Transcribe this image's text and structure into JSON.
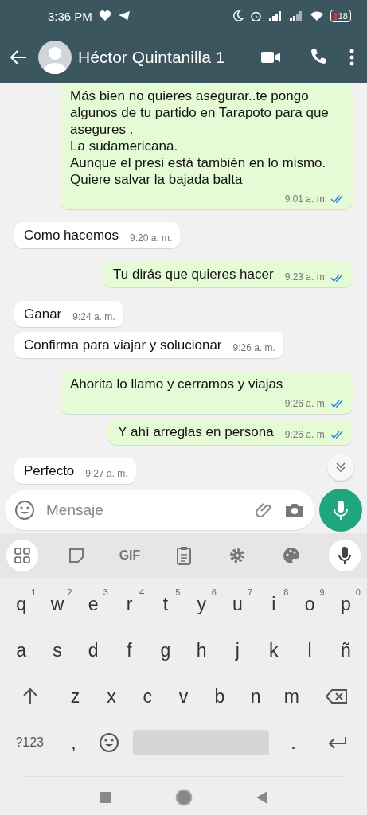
{
  "status_bar": {
    "time": "3:36 PM",
    "battery": "18"
  },
  "header": {
    "contact_name": "Héctor Quintanilla 1"
  },
  "messages": [
    {
      "kind": "out",
      "text": "Más bien no quieres asegurar..te pongo algunos de tu partido en Tarapoto para que asegures .\nLa sudamericana.\nAunque el presi está también en lo mismo.\nQuiere salvar la bajada balta",
      "time": "9:01 a. m.",
      "read": true
    },
    {
      "kind": "in",
      "text": "Como hacemos",
      "time": "9:20 a. m."
    },
    {
      "kind": "out",
      "text": "Tu dirás que quieres hacer",
      "time": "9:23 a. m.",
      "read": true
    },
    {
      "kind": "in",
      "text": "Ganar",
      "time": "9:24 a. m."
    },
    {
      "kind": "in",
      "text": "Confirma para viajar y solucionar",
      "time": "9:26 a. m."
    },
    {
      "kind": "out",
      "text": "Ahorita lo llamo y cerramos y viajas",
      "time": "9:26 a. m.",
      "read": true
    },
    {
      "kind": "out",
      "text": "Y ahí arreglas en persona",
      "time": "9:26 a. m.",
      "read": true
    },
    {
      "kind": "in",
      "text": "Perfecto",
      "time": "9:27 a. m."
    }
  ],
  "composer": {
    "placeholder": "Mensaje"
  },
  "keyboard": {
    "toolbar_gif": "GIF",
    "rows": [
      [
        {
          "kind": "letter",
          "label": "q",
          "hint": "1"
        },
        {
          "kind": "letter",
          "label": "w",
          "hint": "2"
        },
        {
          "kind": "letter",
          "label": "e",
          "hint": "3"
        },
        {
          "kind": "letter",
          "label": "r",
          "hint": "4"
        },
        {
          "kind": "letter",
          "label": "t",
          "hint": "5"
        },
        {
          "kind": "letter",
          "label": "y",
          "hint": "6"
        },
        {
          "kind": "letter",
          "label": "u",
          "hint": "7"
        },
        {
          "kind": "letter",
          "label": "i",
          "hint": "8"
        },
        {
          "kind": "letter",
          "label": "o",
          "hint": "9"
        },
        {
          "kind": "letter",
          "label": "p",
          "hint": "0"
        }
      ],
      [
        {
          "kind": "letter",
          "label": "a"
        },
        {
          "kind": "letter",
          "label": "s"
        },
        {
          "kind": "letter",
          "label": "d"
        },
        {
          "kind": "letter",
          "label": "f"
        },
        {
          "kind": "letter",
          "label": "g"
        },
        {
          "kind": "letter",
          "label": "h"
        },
        {
          "kind": "letter",
          "label": "j"
        },
        {
          "kind": "letter",
          "label": "k"
        },
        {
          "kind": "letter",
          "label": "l"
        },
        {
          "kind": "letter",
          "label": "ñ"
        }
      ],
      [
        {
          "kind": "shift"
        },
        {
          "kind": "letter",
          "label": "z"
        },
        {
          "kind": "letter",
          "label": "x"
        },
        {
          "kind": "letter",
          "label": "c"
        },
        {
          "kind": "letter",
          "label": "v"
        },
        {
          "kind": "letter",
          "label": "b"
        },
        {
          "kind": "letter",
          "label": "n"
        },
        {
          "kind": "letter",
          "label": "m"
        },
        {
          "kind": "backspace"
        }
      ],
      [
        {
          "kind": "symbols",
          "label": "?123"
        },
        {
          "kind": "letter",
          "label": ","
        },
        {
          "kind": "emoji"
        },
        {
          "kind": "space"
        },
        {
          "kind": "letter",
          "label": "."
        },
        {
          "kind": "enter"
        }
      ]
    ]
  }
}
